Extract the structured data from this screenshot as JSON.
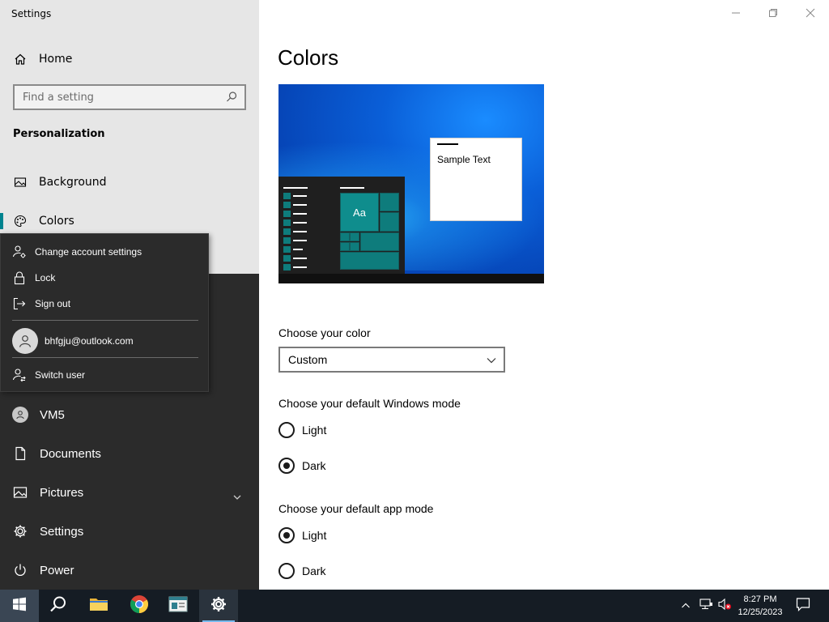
{
  "window": {
    "app_title": "Settings"
  },
  "nav": {
    "home_label": "Home",
    "search_placeholder": "Find a setting",
    "section_header": "Personalization",
    "items": [
      {
        "label": "Background",
        "icon": "image-icon"
      },
      {
        "label": "Colors",
        "icon": "palette-icon",
        "active": true
      }
    ]
  },
  "main": {
    "title": "Colors",
    "preview": {
      "sample_text": "Sample Text",
      "tile_text": "Aa"
    },
    "choose_color_label": "Choose your color",
    "color_select_value": "Custom",
    "windows_mode_label": "Choose your default Windows mode",
    "windows_mode_options": [
      {
        "label": "Light",
        "checked": false
      },
      {
        "label": "Dark",
        "checked": true
      }
    ],
    "app_mode_label": "Choose your default app mode",
    "app_mode_options": [
      {
        "label": "Light",
        "checked": true
      },
      {
        "label": "Dark",
        "checked": false
      }
    ]
  },
  "account_flyout": {
    "change_account_settings": "Change account settings",
    "lock": "Lock",
    "sign_out": "Sign out",
    "email": "bhfgju@outlook.com",
    "switch_user": "Switch user"
  },
  "start_menu": {
    "items": [
      {
        "label": "VM5",
        "icon": "user-avatar-icon"
      },
      {
        "label": "Documents",
        "icon": "document-icon"
      },
      {
        "label": "Pictures",
        "icon": "pictures-icon"
      },
      {
        "label": "Settings",
        "icon": "gear-icon"
      },
      {
        "label": "Power",
        "icon": "power-icon"
      }
    ]
  },
  "taskbar": {
    "time": "8:27 PM",
    "date": "12/25/2023"
  },
  "colors": {
    "accent": "#00838f",
    "start_bg": "#2b2b2b",
    "taskbar_bg": "#151c24"
  }
}
